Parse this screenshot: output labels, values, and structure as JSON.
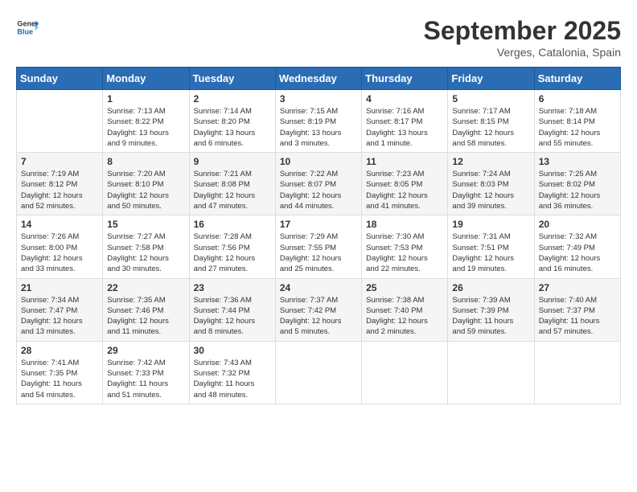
{
  "logo": {
    "text_general": "General",
    "text_blue": "Blue"
  },
  "title": {
    "month_year": "September 2025",
    "location": "Verges, Catalonia, Spain"
  },
  "weekdays": [
    "Sunday",
    "Monday",
    "Tuesday",
    "Wednesday",
    "Thursday",
    "Friday",
    "Saturday"
  ],
  "weeks": [
    [
      {
        "day": "",
        "info": ""
      },
      {
        "day": "1",
        "info": "Sunrise: 7:13 AM\nSunset: 8:22 PM\nDaylight: 13 hours\nand 9 minutes."
      },
      {
        "day": "2",
        "info": "Sunrise: 7:14 AM\nSunset: 8:20 PM\nDaylight: 13 hours\nand 6 minutes."
      },
      {
        "day": "3",
        "info": "Sunrise: 7:15 AM\nSunset: 8:19 PM\nDaylight: 13 hours\nand 3 minutes."
      },
      {
        "day": "4",
        "info": "Sunrise: 7:16 AM\nSunset: 8:17 PM\nDaylight: 13 hours\nand 1 minute."
      },
      {
        "day": "5",
        "info": "Sunrise: 7:17 AM\nSunset: 8:15 PM\nDaylight: 12 hours\nand 58 minutes."
      },
      {
        "day": "6",
        "info": "Sunrise: 7:18 AM\nSunset: 8:14 PM\nDaylight: 12 hours\nand 55 minutes."
      }
    ],
    [
      {
        "day": "7",
        "info": "Sunrise: 7:19 AM\nSunset: 8:12 PM\nDaylight: 12 hours\nand 52 minutes."
      },
      {
        "day": "8",
        "info": "Sunrise: 7:20 AM\nSunset: 8:10 PM\nDaylight: 12 hours\nand 50 minutes."
      },
      {
        "day": "9",
        "info": "Sunrise: 7:21 AM\nSunset: 8:08 PM\nDaylight: 12 hours\nand 47 minutes."
      },
      {
        "day": "10",
        "info": "Sunrise: 7:22 AM\nSunset: 8:07 PM\nDaylight: 12 hours\nand 44 minutes."
      },
      {
        "day": "11",
        "info": "Sunrise: 7:23 AM\nSunset: 8:05 PM\nDaylight: 12 hours\nand 41 minutes."
      },
      {
        "day": "12",
        "info": "Sunrise: 7:24 AM\nSunset: 8:03 PM\nDaylight: 12 hours\nand 39 minutes."
      },
      {
        "day": "13",
        "info": "Sunrise: 7:25 AM\nSunset: 8:02 PM\nDaylight: 12 hours\nand 36 minutes."
      }
    ],
    [
      {
        "day": "14",
        "info": "Sunrise: 7:26 AM\nSunset: 8:00 PM\nDaylight: 12 hours\nand 33 minutes."
      },
      {
        "day": "15",
        "info": "Sunrise: 7:27 AM\nSunset: 7:58 PM\nDaylight: 12 hours\nand 30 minutes."
      },
      {
        "day": "16",
        "info": "Sunrise: 7:28 AM\nSunset: 7:56 PM\nDaylight: 12 hours\nand 27 minutes."
      },
      {
        "day": "17",
        "info": "Sunrise: 7:29 AM\nSunset: 7:55 PM\nDaylight: 12 hours\nand 25 minutes."
      },
      {
        "day": "18",
        "info": "Sunrise: 7:30 AM\nSunset: 7:53 PM\nDaylight: 12 hours\nand 22 minutes."
      },
      {
        "day": "19",
        "info": "Sunrise: 7:31 AM\nSunset: 7:51 PM\nDaylight: 12 hours\nand 19 minutes."
      },
      {
        "day": "20",
        "info": "Sunrise: 7:32 AM\nSunset: 7:49 PM\nDaylight: 12 hours\nand 16 minutes."
      }
    ],
    [
      {
        "day": "21",
        "info": "Sunrise: 7:34 AM\nSunset: 7:47 PM\nDaylight: 12 hours\nand 13 minutes."
      },
      {
        "day": "22",
        "info": "Sunrise: 7:35 AM\nSunset: 7:46 PM\nDaylight: 12 hours\nand 11 minutes."
      },
      {
        "day": "23",
        "info": "Sunrise: 7:36 AM\nSunset: 7:44 PM\nDaylight: 12 hours\nand 8 minutes."
      },
      {
        "day": "24",
        "info": "Sunrise: 7:37 AM\nSunset: 7:42 PM\nDaylight: 12 hours\nand 5 minutes."
      },
      {
        "day": "25",
        "info": "Sunrise: 7:38 AM\nSunset: 7:40 PM\nDaylight: 12 hours\nand 2 minutes."
      },
      {
        "day": "26",
        "info": "Sunrise: 7:39 AM\nSunset: 7:39 PM\nDaylight: 11 hours\nand 59 minutes."
      },
      {
        "day": "27",
        "info": "Sunrise: 7:40 AM\nSunset: 7:37 PM\nDaylight: 11 hours\nand 57 minutes."
      }
    ],
    [
      {
        "day": "28",
        "info": "Sunrise: 7:41 AM\nSunset: 7:35 PM\nDaylight: 11 hours\nand 54 minutes."
      },
      {
        "day": "29",
        "info": "Sunrise: 7:42 AM\nSunset: 7:33 PM\nDaylight: 11 hours\nand 51 minutes."
      },
      {
        "day": "30",
        "info": "Sunrise: 7:43 AM\nSunset: 7:32 PM\nDaylight: 11 hours\nand 48 minutes."
      },
      {
        "day": "",
        "info": ""
      },
      {
        "day": "",
        "info": ""
      },
      {
        "day": "",
        "info": ""
      },
      {
        "day": "",
        "info": ""
      }
    ]
  ]
}
